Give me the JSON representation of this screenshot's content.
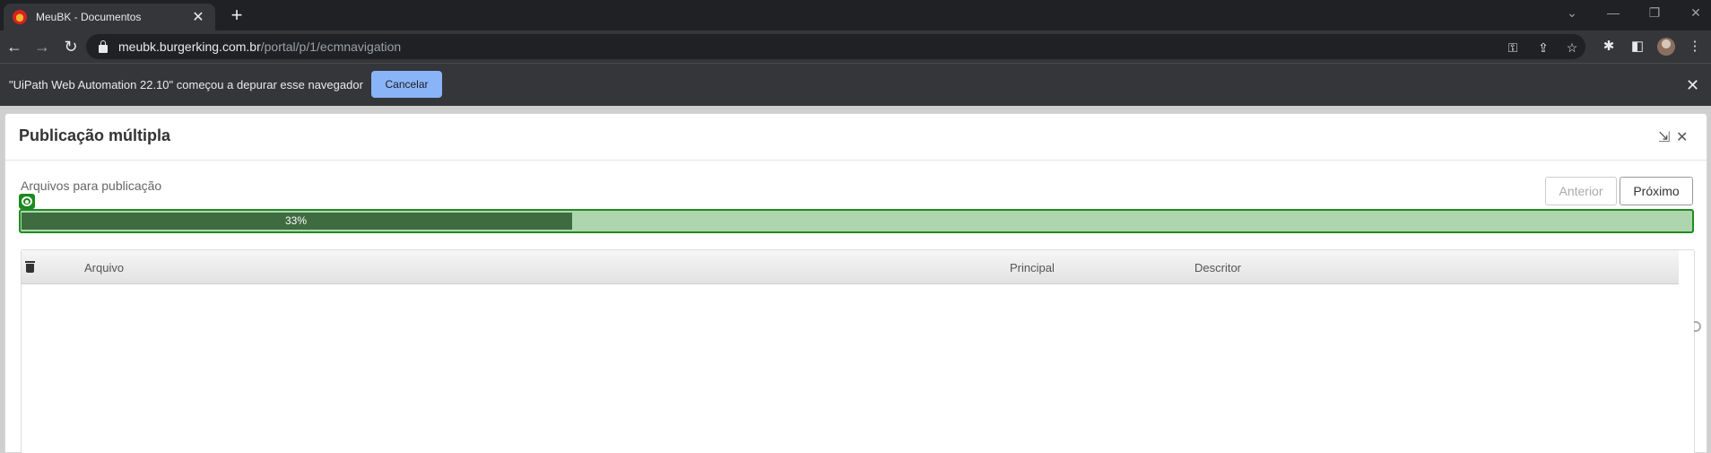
{
  "browser": {
    "tab_title": "MeuBK - Documentos",
    "tab_close_icon": "close-icon",
    "new_tab_icon": "plus-icon",
    "url_host": "meubk.burgerking.com.br",
    "url_path": "/portal/p/1/ecmnavigation"
  },
  "infobar": {
    "message": "\"UiPath Web Automation 22.10\" começou a depurar esse navegador",
    "cancel_label": "Cancelar"
  },
  "modal": {
    "title": "Publicação múltipla",
    "section_label": "Arquivos para publicação",
    "prev_label": "Anterior",
    "next_label": "Próximo",
    "progress": {
      "value": 0.33,
      "label": "33%"
    },
    "table": {
      "columns": [
        "Arquivo",
        "Principal",
        "Descritor"
      ],
      "rows": []
    }
  },
  "colors": {
    "progress_fill": "#3f6b41",
    "progress_track": "#aed6ae",
    "progress_border": "#1f8c1f",
    "infobar_button": "#8ab4f8"
  }
}
